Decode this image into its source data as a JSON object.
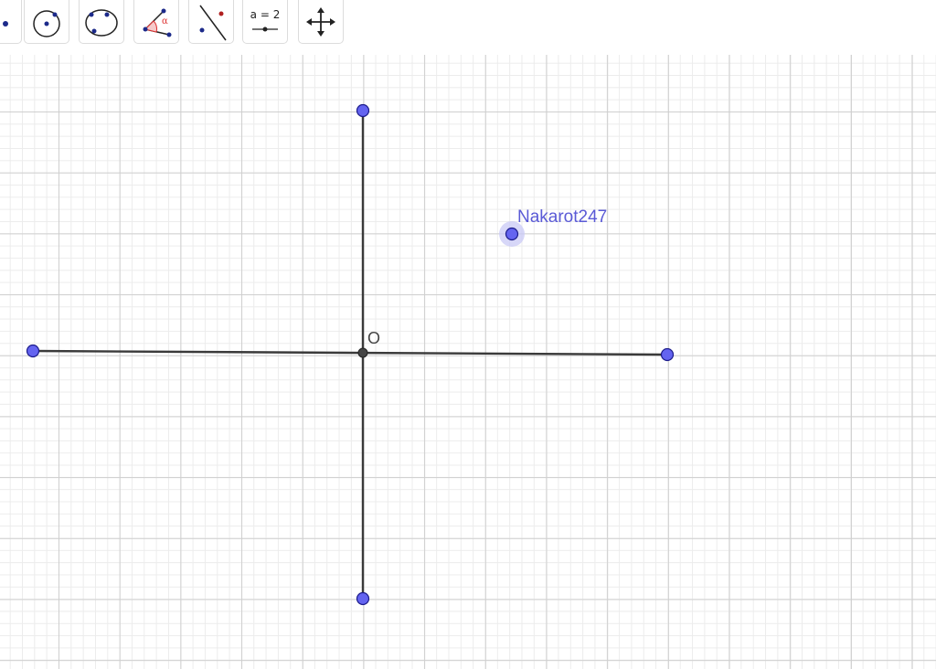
{
  "toolbar": {
    "tools": [
      {
        "name": "point-tool-partial",
        "icon": "point-icon"
      },
      {
        "name": "circle-center-point-tool",
        "icon": "circle-center-point-icon"
      },
      {
        "name": "circle-three-points-tool",
        "icon": "circle-three-points-icon"
      },
      {
        "name": "angle-tool",
        "icon": "angle-icon",
        "symbol": "α"
      },
      {
        "name": "reflect-about-line-tool",
        "icon": "reflect-line-icon"
      },
      {
        "name": "slider-tool",
        "icon": "slider-icon",
        "label": "a = 2"
      },
      {
        "name": "move-graphics-view-tool",
        "icon": "move-arrows-icon"
      }
    ]
  },
  "canvas": {
    "origin_label": "O",
    "point_label": "Nakarot247",
    "colors": {
      "point_fill": "#6464f0",
      "point_stroke": "#1c1c8a",
      "segment": "#3a3a3a",
      "label": "#5a5ad6",
      "grid_major": "#cfcfcf",
      "grid_minor": "#ececec"
    }
  }
}
